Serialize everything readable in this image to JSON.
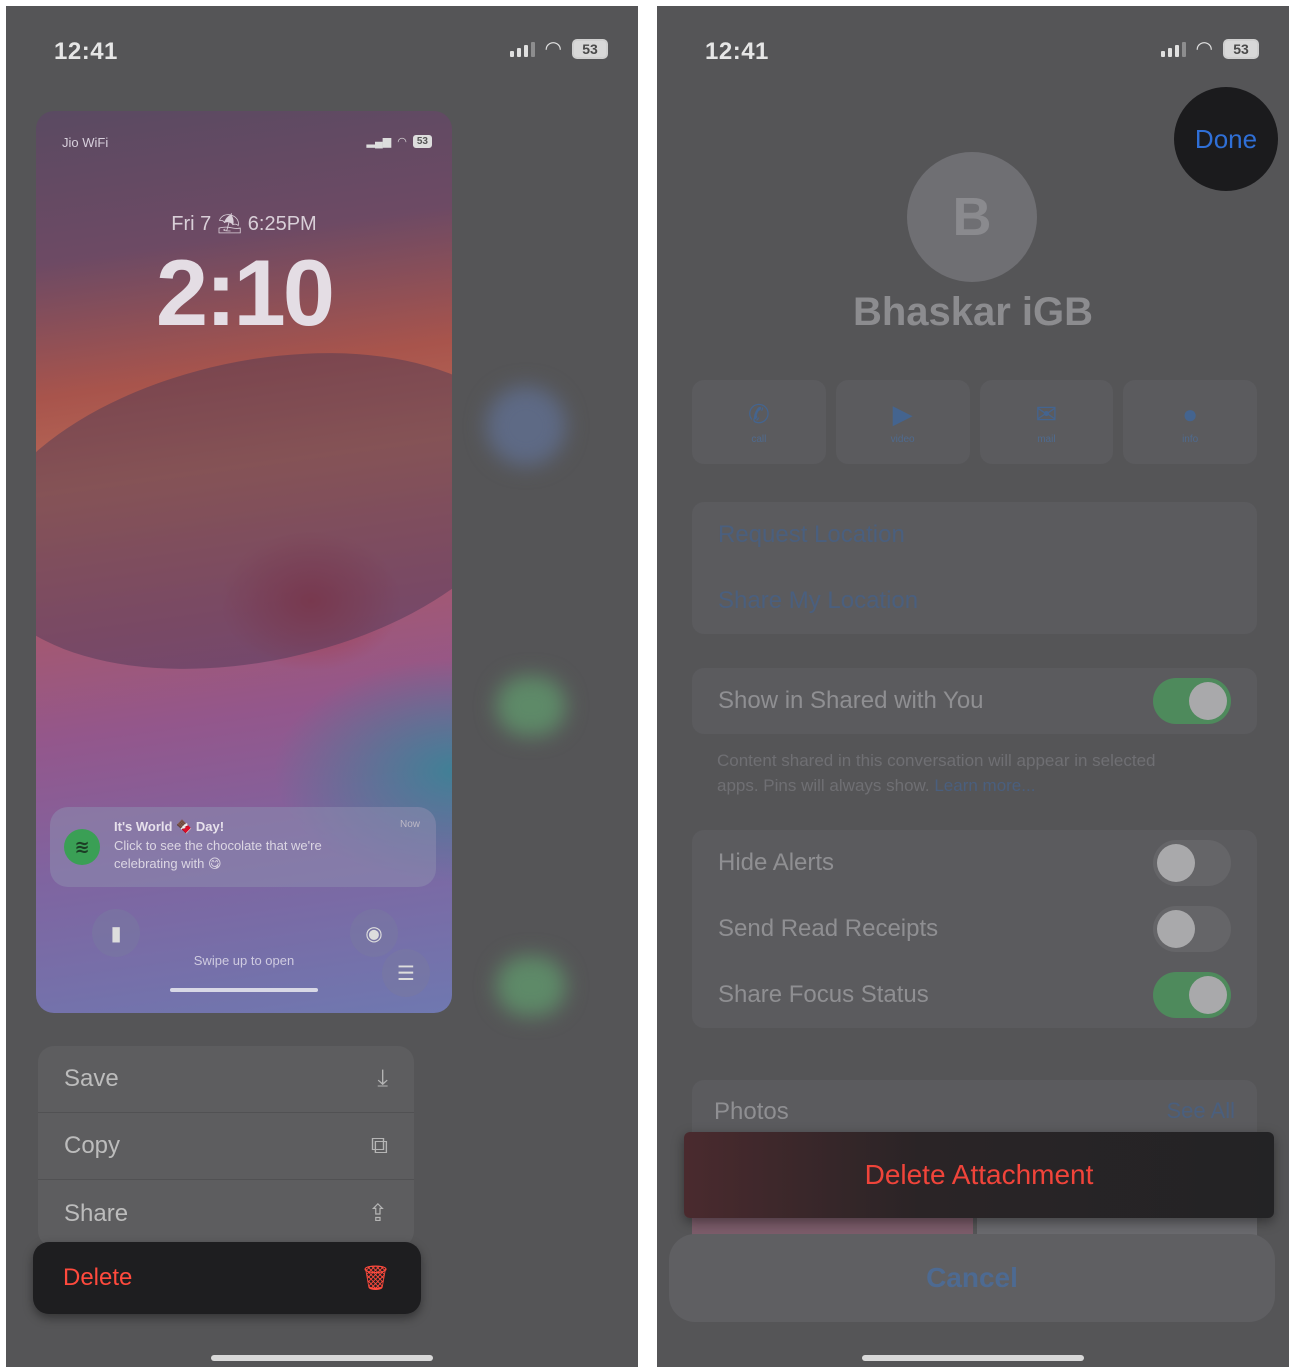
{
  "left_screen": {
    "status_time": "12:41",
    "battery": "53",
    "lock_preview": {
      "carrier": "Jio WiFi",
      "battery": "53",
      "date_line": "Fri 7 ⛱ 6:25PM",
      "time": "2:10",
      "notification": {
        "title": "It's World 🍫 Day!",
        "body": "Click to see the chocolate that we're celebrating with 😋",
        "time": "Now"
      },
      "swipe_hint": "Swipe up to open"
    },
    "menu": {
      "items": [
        {
          "label": "Save",
          "icon": "save-icon",
          "glyph": "⤓"
        },
        {
          "label": "Copy",
          "icon": "copy-icon",
          "glyph": "⧉"
        },
        {
          "label": "Share",
          "icon": "share-icon",
          "glyph": "⇪"
        }
      ],
      "delete_label": "Delete",
      "delete_icon": "trash-icon"
    }
  },
  "right_screen": {
    "status_time": "12:41",
    "battery": "53",
    "done_label": "Done",
    "avatar_initial": "B",
    "contact_name": "Bhaskar iGB",
    "actions": [
      {
        "icon": "phone-icon",
        "glyph": "✆",
        "label": "call"
      },
      {
        "icon": "video-icon",
        "glyph": "▶",
        "label": "video"
      },
      {
        "icon": "mail-icon",
        "glyph": "✉",
        "label": "mail"
      },
      {
        "icon": "info-icon",
        "glyph": "●",
        "label": "info"
      }
    ],
    "location": {
      "request": "Request Location",
      "share": "Share My Location"
    },
    "shared_with_you": {
      "label": "Show in Shared with You",
      "on": true,
      "footnote": "Content shared in this conversation will appear in selected apps. Pins will always show.",
      "learn_more": "Learn more..."
    },
    "toggles": [
      {
        "label": "Hide Alerts",
        "on": false
      },
      {
        "label": "Send Read Receipts",
        "on": false
      },
      {
        "label": "Share Focus Status",
        "on": true
      }
    ],
    "photos": {
      "label": "Photos",
      "see_all": "See All"
    },
    "delete_attachment": "Delete Attachment",
    "cancel": "Cancel"
  },
  "colors": {
    "destructive": "#ff4a3d",
    "link": "#2f6fd6",
    "toggle_on": "#4e8a5c"
  }
}
